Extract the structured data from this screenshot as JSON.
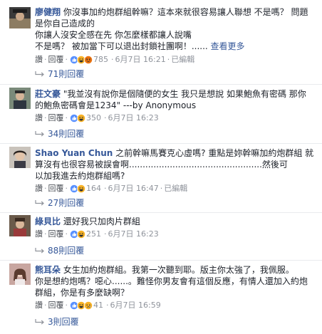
{
  "comments": [
    {
      "author": "廖健翔",
      "lines": [
        "你沒事加約炮群組幹嘛？這本來就很容易讓人聯想 不是嗎？ 問題",
        "是你自己造成的",
        "你讓人沒安全感在先 你怎麼樣都讓人說嘴",
        "不是嗎？ 被加當下可以退出封鎖社團啊！......"
      ],
      "see_more": "查看更多",
      "like": "讚",
      "reply": "回覆",
      "reaction_count": "785",
      "time": "6月7日 16:21",
      "edited": "已編輯",
      "replies": "71則回覆"
    },
    {
      "author": "莊文豪",
      "lines": [
        "\"我並沒有說你是個隨便的女生 我只是想說 如果鮑魚有密碼 那你",
        "的鮑魚密碼會是1234\" ---by Anonymous"
      ],
      "like": "讚",
      "reply": "回覆",
      "reaction_count": "350",
      "time": "6月7日 16:23",
      "replies": "34則回覆"
    },
    {
      "author": "Shao Yuan Chun",
      "lines": [
        "之前幹嘛馬賽克心虛嗎? 重點是妳幹嘛加約炮群組 就",
        "算沒有也很容易被誤會啊.................................................然後可",
        "以加我進去約炮群組嗎?"
      ],
      "like": "讚",
      "reply": "回覆",
      "reaction_count": "164",
      "time": "6月7日 16:47",
      "edited": "已編輯",
      "replies": "27則回覆"
    },
    {
      "author": "綠貝比",
      "lines": [
        "還好我只加肉片群組"
      ],
      "like": "讚",
      "reply": "回覆",
      "reaction_count": "251",
      "time": "6月7日 16:23",
      "replies": "88則回覆"
    },
    {
      "author": "熊耳朵",
      "lines": [
        "女生加約炮群組。我第一次聽到耶。版主你太強了，我佩服。",
        "你是想約炮嗎？噁心......。難怪你男友會有這個反應，有情人還加入約炮",
        "群組，你是有多麼缺啊？"
      ],
      "like": "讚",
      "reply": "回覆",
      "reaction_count": "41",
      "time": "6月7日 16:59",
      "replies": "3則回覆"
    }
  ],
  "colors": {
    "link": "#365899",
    "meta": "#90949c",
    "text": "#1d2129",
    "like_blue": "#5890ff",
    "haha_yellow": "#f7b125",
    "angry_red": "#e9710f"
  },
  "icons": [
    "like-reaction-icon",
    "haha-reaction-icon",
    "sad-reaction-icon",
    "angry-reaction-icon",
    "reply-arrow-icon"
  ]
}
